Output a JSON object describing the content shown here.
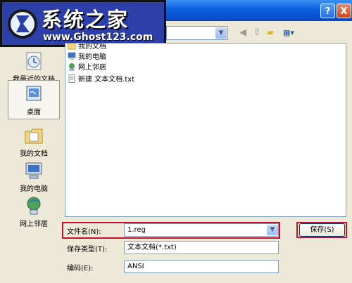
{
  "window": {
    "help_label": "?",
    "close_label": "X"
  },
  "watermark": {
    "title": "系统之家",
    "url": "www.Ghost123.com"
  },
  "toolbar": {
    "back_icon": "back-arrow-icon",
    "up_icon": "up-folder-icon",
    "new_folder_icon": "new-folder-icon",
    "views_icon": "views-menu-icon"
  },
  "places": [
    {
      "label": "我最近的文档",
      "icon": "recent-documents-icon"
    },
    {
      "label": "桌面",
      "icon": "desktop-icon"
    },
    {
      "label": "我的文档",
      "icon": "my-documents-icon"
    },
    {
      "label": "我的电脑",
      "icon": "my-computer-icon"
    },
    {
      "label": "网上邻居",
      "icon": "network-places-icon"
    }
  ],
  "files": [
    {
      "name": "我的文档",
      "icon": "folder-icon"
    },
    {
      "name": "我的电脑",
      "icon": "computer-icon"
    },
    {
      "name": "网上邻居",
      "icon": "network-icon"
    },
    {
      "name": "新建 文本文档.txt",
      "icon": "text-file-icon"
    }
  ],
  "form": {
    "filename_label": "文件名(N):",
    "filename_value": "1.reg",
    "filetype_label": "保存类型(T):",
    "filetype_value": "文本文档(*.txt)",
    "encoding_label": "编码(E):",
    "encoding_value": "ANSI",
    "save_label": "保存(S)"
  },
  "colors": {
    "highlight_frame": "#c8102e",
    "titlebar": "#0a52cf"
  }
}
